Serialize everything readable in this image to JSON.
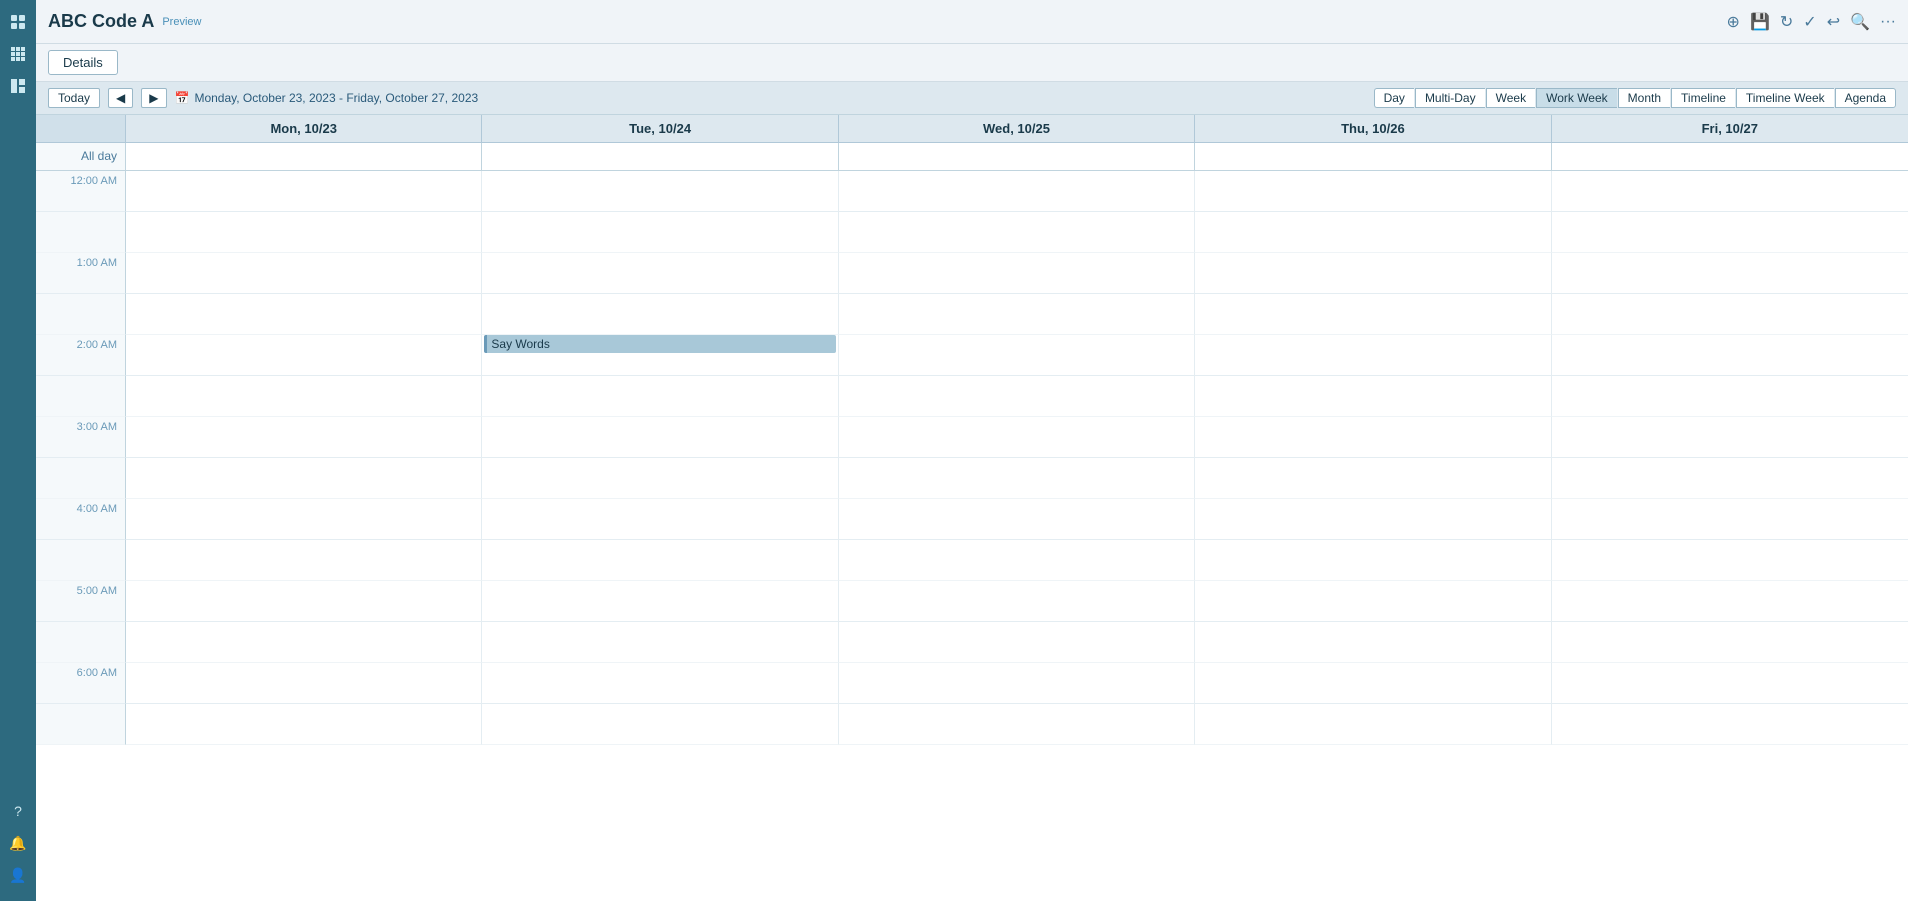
{
  "sidebar": {
    "icons": [
      "grid-icon",
      "apps-icon",
      "grid2-icon"
    ],
    "bottom_icons": [
      "help-icon",
      "bell-icon",
      "user-icon"
    ]
  },
  "topbar": {
    "title": "ABC Code A",
    "preview_label": "Preview",
    "actions": [
      "plus-icon",
      "save-icon",
      "refresh-icon",
      "check-icon",
      "undo-icon",
      "search-icon",
      "more-icon"
    ]
  },
  "details_button": "Details",
  "calendar": {
    "today_label": "Today",
    "nav_prev": "◄",
    "nav_next": "►",
    "date_range": "Monday, October 23, 2023 - Friday, October 27, 2023",
    "calendar_icon": "📅",
    "views": [
      "Day",
      "Multi-Day",
      "Week",
      "Work Week",
      "Month",
      "Timeline",
      "Timeline Week",
      "Agenda"
    ],
    "active_view": "Work Week",
    "headers": [
      "",
      "Mon, 10/23",
      "Tue, 10/24",
      "Wed, 10/25",
      "Thu, 10/26",
      "Fri, 10/27"
    ],
    "allday_label": "All day",
    "hours": [
      "12:00 AM",
      "1:00 AM",
      "2:00 AM",
      "3:00 AM",
      "4:00 AM",
      "5:00 AM",
      "6:00 AM"
    ],
    "event": {
      "title": "Say Words",
      "day_column": 1,
      "hour": "2:00 AM"
    }
  }
}
